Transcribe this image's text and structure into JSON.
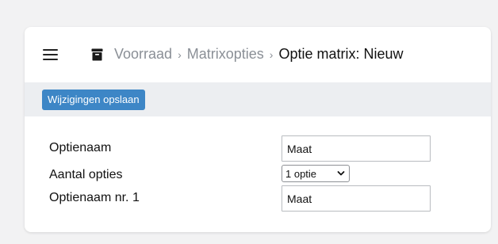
{
  "header": {
    "menu_icon": "hamburger-menu-icon",
    "section_icon": "archive-box-icon",
    "breadcrumb": [
      {
        "label": "Voorraad"
      },
      {
        "label": "Matrixopties"
      }
    ],
    "separator": "›",
    "current": "Optie matrix: Nieuw"
  },
  "toolbar": {
    "save_label": "Wijzigingen opslaan",
    "save_color": "#3d86c6"
  },
  "form": {
    "option_name": {
      "label": "Optienaam",
      "value": "Maat"
    },
    "option_count": {
      "label": "Aantal opties",
      "selected": "1 optie"
    },
    "option_name_1": {
      "label": "Optienaam nr. 1",
      "value": "Maat"
    }
  }
}
